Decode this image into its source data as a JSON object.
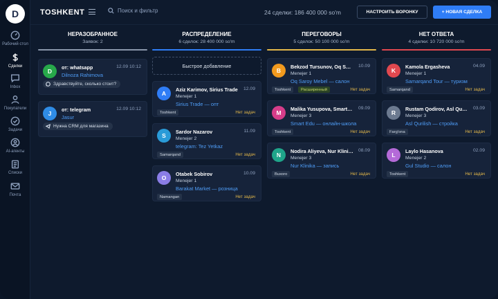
{
  "sidebar": {
    "logo": "D",
    "items": [
      {
        "label": "Рабочий стол",
        "icon": "gauge-icon"
      },
      {
        "label": "Сделки",
        "icon": "dollar-icon",
        "active": true
      },
      {
        "label": "Inbox",
        "icon": "chat-bubble-icon"
      },
      {
        "label": "Покупатели",
        "icon": "user-icon"
      },
      {
        "label": "Задачи",
        "icon": "check-circle-icon"
      },
      {
        "label": "AI-агенты",
        "icon": "ai-agent-icon"
      },
      {
        "label": "Списки",
        "icon": "clipboard-icon"
      },
      {
        "label": "Почта",
        "icon": "mail-icon"
      }
    ]
  },
  "header": {
    "brand": "TOSHKENT",
    "search_placeholder": "Поиск и фильтр",
    "summary": "24 сделки: 186 400 000 so'm",
    "setup_button": "НАСТРОИТЬ ВОРОНКУ",
    "new_deal_button": "+ НОВАЯ СДЕЛКА"
  },
  "colors": {
    "accent": "#2f7df6",
    "col_unsorted": "#8a97ab",
    "col_distribution": "#2f7df6",
    "col_negotiation": "#e3b84a",
    "col_no_answer": "#e0484f"
  },
  "columns": {
    "unsorted": {
      "title": "НЕРАЗОБРАННОЕ",
      "subtitle": "Заявок: 2",
      "items": [
        {
          "avatar": "D",
          "color": "#27a84a",
          "source": "от: whatsapp",
          "date": "12.09 10:12",
          "name": "Dilnoza Rahimova",
          "message": "Здравствуйте, сколько стоит?",
          "icon": "whatsapp-icon"
        },
        {
          "avatar": "J",
          "color": "#2f8ce6",
          "source": "от: telegram",
          "date": "12.09 10:12",
          "name": "Jasur",
          "message": "Нужна CRM для магазина",
          "icon": "telegram-icon"
        }
      ]
    },
    "distribution": {
      "title": "РАСПРЕДЕЛЕНИЕ",
      "subtitle": "6 сделок: 28 400 000 so'm",
      "quick_add": "Быстрое добавление",
      "cards": [
        {
          "avatar": "A",
          "color": "#2f7df6",
          "name": "Aziz Karimov, Sirius Trade",
          "date": "12.09",
          "manager": "Menejer 1",
          "deal": "Sirius Trade — опт",
          "tag": "Toshkent",
          "status": "Нет задач"
        },
        {
          "avatar": "S",
          "color": "#2a9bd8",
          "name": "Sardor Nazarov",
          "date": "11.09",
          "manager": "Menejer 2",
          "deal": "telegram: Tez Yetkaz",
          "tag": "Samarqand",
          "status": "Нет задач"
        },
        {
          "avatar": "O",
          "color": "#8a7de6",
          "name": "Otabek Sobirov",
          "date": "10.09",
          "manager": "Menejer 1",
          "deal": "Barakat Market — розница",
          "tag": "Namangan",
          "status": "Нет задач"
        }
      ]
    },
    "negotiation": {
      "title": "ПЕРЕГОВОРЫ",
      "subtitle": "5 сделок: 50 100 000 so'm",
      "cards": [
        {
          "avatar": "B",
          "color": "#f29a1e",
          "name": "Bekzod Tursunov, Oq Saroy",
          "date": "10.09",
          "manager": "Menejer 1",
          "deal": "Oq Saroy Mebel — салон",
          "tag": "Toshkent",
          "tag2": "Расширенный",
          "status": "Нет задач"
        },
        {
          "avatar": "M",
          "color": "#d63d8a",
          "name": "Malika Yusupova, Smart Edu",
          "date": "09.09",
          "manager": "Menejer 3",
          "deal": "Smart Edu — онлайн-школа",
          "tag": "Toshkent",
          "status": "Нет задач"
        },
        {
          "avatar": "N",
          "color": "#1fa58a",
          "name": "Nodira Aliyeva, Nur Klinika",
          "date": "08.09",
          "manager": "Menejer 3",
          "deal": "Nur Klinika — запись",
          "tag": "Buxoro",
          "status": "Нет задач"
        }
      ]
    },
    "no_answer": {
      "title": "НЕТ ОТВЕТА",
      "subtitle": "4 сделки: 10 720 000 so'm",
      "cards": [
        {
          "avatar": "K",
          "color": "#e0484f",
          "name": "Kamola Ergasheva",
          "date": "04.09",
          "manager": "Menejer 1",
          "deal": "Samarqand Tour — туризм",
          "tag": "Samarqand",
          "status": "Нет задач"
        },
        {
          "avatar": "R",
          "color": "#6c7a90",
          "name": "Rustam Qodirov, Asl Qurilish",
          "date": "03.09",
          "manager": "Menejer 3",
          "deal": "Asl Qurilish — стройка",
          "tag": "Farg'ona",
          "status": "Нет задач"
        },
        {
          "avatar": "L",
          "color": "#b46ad8",
          "name": "Laylo Hasanova",
          "date": "02.09",
          "manager": "Menejer 2",
          "deal": "Gul Studio — салон",
          "tag": "Toshkent",
          "status": "Нет задач"
        }
      ]
    }
  }
}
